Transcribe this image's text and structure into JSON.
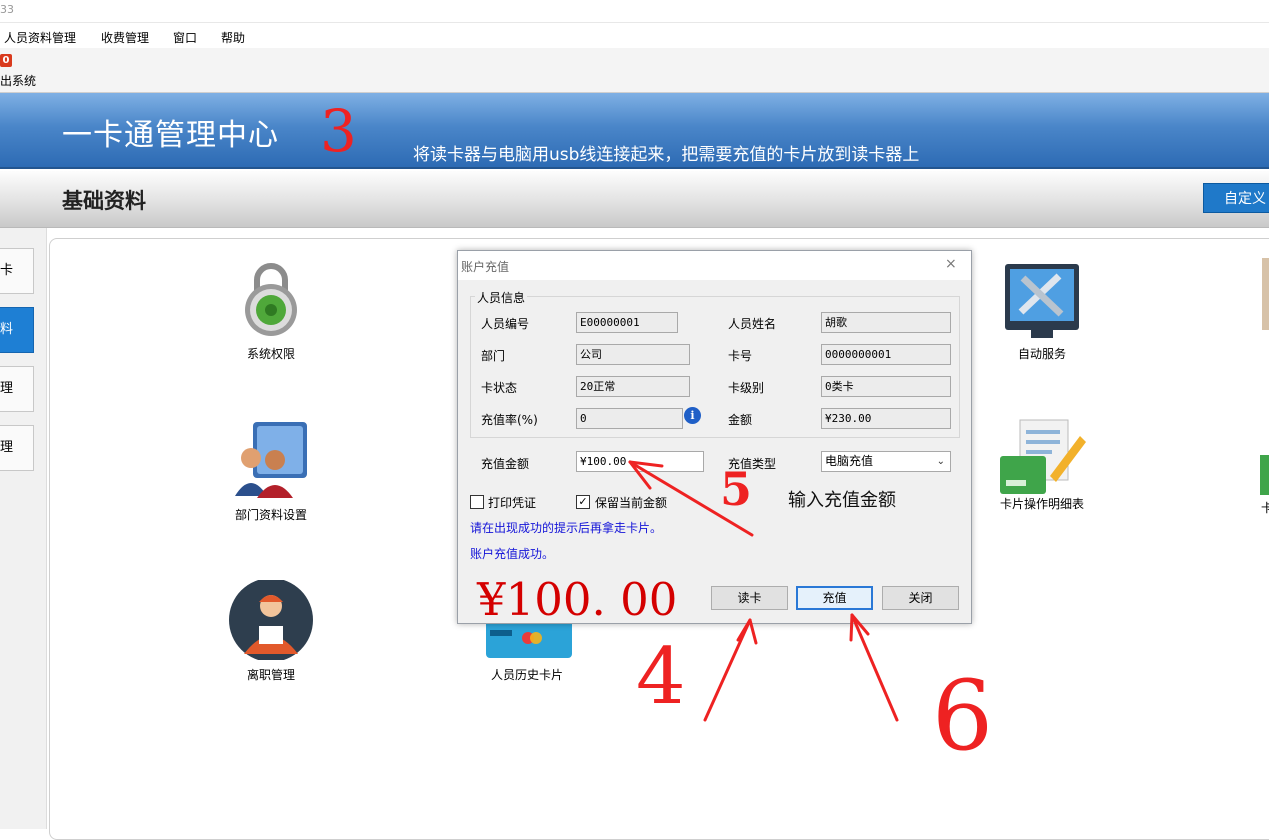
{
  "window": {
    "title_fragment": "33"
  },
  "menu": [
    "人员资料管理",
    "收费管理",
    "窗口",
    "帮助"
  ],
  "toolbar": {
    "exit_badge": "0",
    "exit_label": "出系统"
  },
  "banner": {
    "title": "一卡通管理中心",
    "note": "将读卡器与电脑用usb线连接起来，把需要充值的卡片放到读卡器上"
  },
  "section": {
    "title": "基础资料",
    "custom_button": "自定义"
  },
  "sidebar": [
    "卡",
    "料",
    "理",
    "理"
  ],
  "tiles": {
    "system_permission": "系统权限",
    "department_setup": "部门资料设置",
    "resign_manage": "离职管理",
    "history_card": "人员历史卡片",
    "self_service": "自动服务",
    "card_op_detail": "卡片操作明细表",
    "edge_right": "卡"
  },
  "dialog": {
    "title": "账户充值",
    "close": "×",
    "group_label": "人员信息",
    "fields": {
      "emp_no_label": "人员编号",
      "emp_no": "E00000001",
      "emp_name_label": "人员姓名",
      "emp_name": "胡歌",
      "dept_label": "部门",
      "dept": "公司",
      "card_no_label": "卡号",
      "card_no": "0000000001",
      "card_status_label": "卡状态",
      "card_status": "20正常",
      "card_level_label": "卡级别",
      "card_level": "0类卡",
      "rate_label": "充值率(%)",
      "rate": "0",
      "balance_label": "金额",
      "balance": "¥230.00"
    },
    "recharge_amount_label": "充值金额",
    "recharge_amount": "¥100.00",
    "recharge_type_label": "充值类型",
    "recharge_type": "电脑充值",
    "print_voucher": "打印凭证",
    "keep_amount": "保留当前金额",
    "hint": "请在出现成功的提示后再拿走卡片。",
    "success": "账户充值成功。",
    "big_amount": "¥100. 00",
    "buttons": {
      "read_card": "读卡",
      "recharge": "充值",
      "close": "关闭"
    }
  },
  "annotations": {
    "n3": "3",
    "n4": "4",
    "n5": "5",
    "n6": "6",
    "input_note": "输入充值金额"
  }
}
